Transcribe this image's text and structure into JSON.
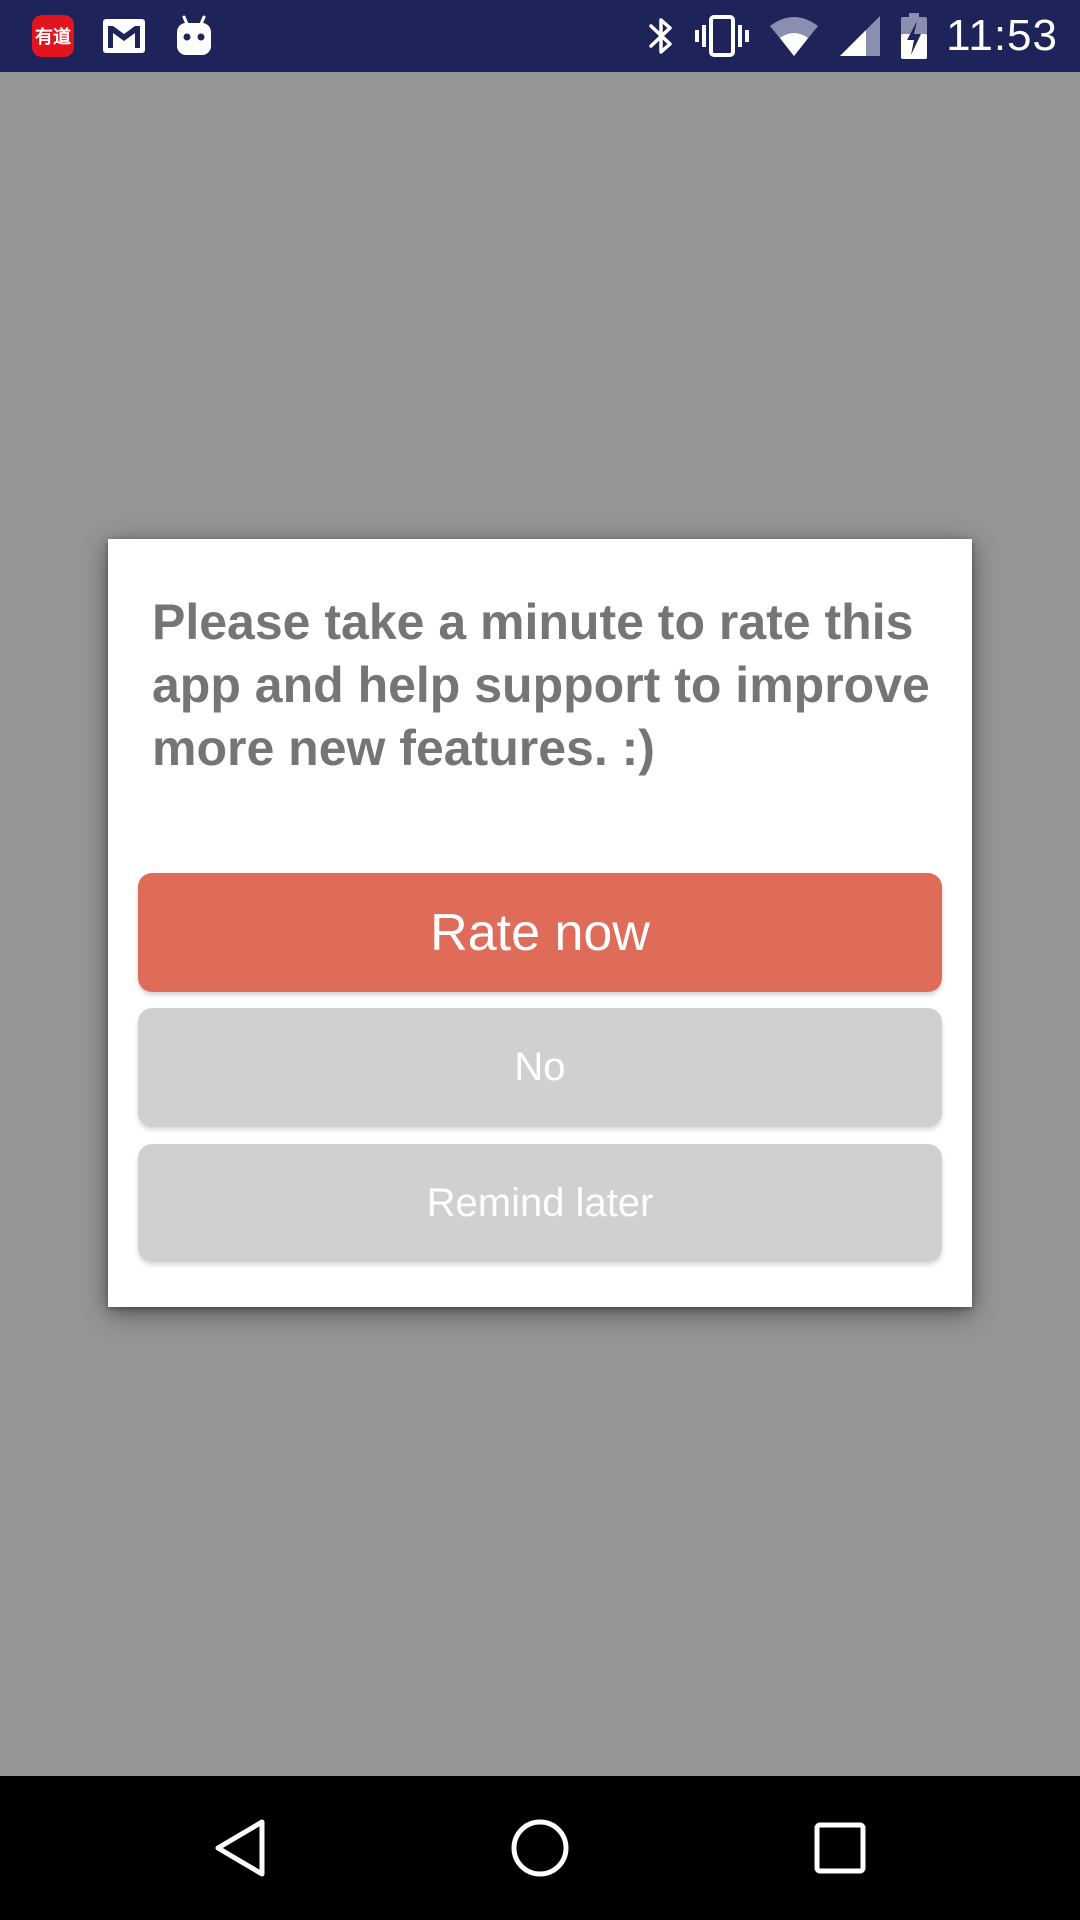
{
  "status_bar": {
    "time": "11:53",
    "background": "#1e235a",
    "left_icons": [
      "youdao-icon",
      "gmail-icon",
      "android-robot-icon"
    ],
    "right_icons": [
      "bluetooth-icon",
      "vibrate-icon",
      "wifi-icon",
      "cell-signal-icon",
      "battery-charging-icon"
    ],
    "youdao_glyph": "有道"
  },
  "dialog": {
    "message": "Please take a minute to rate this app and help support to improve more new features. :)",
    "rate_button": "Rate now",
    "no_button": "No",
    "later_button": "Remind later",
    "colors": {
      "rate": "#df6c59",
      "secondary": "#d0d0d0",
      "message_text": "#757575"
    }
  },
  "nav_bar": {
    "icons": [
      "back-icon",
      "home-icon",
      "recents-icon"
    ]
  }
}
